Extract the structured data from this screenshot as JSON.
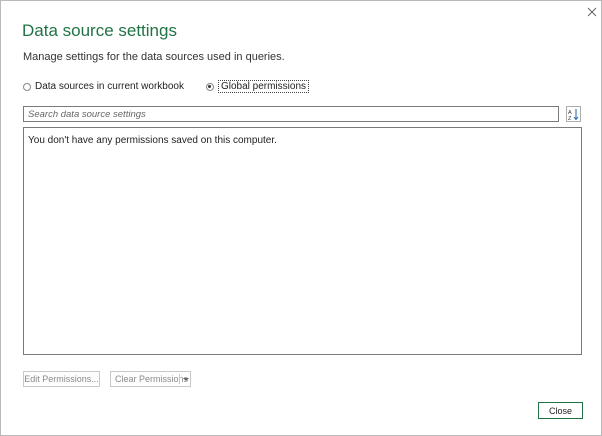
{
  "dialog": {
    "title": "Data source settings",
    "subtitle": "Manage settings for the data sources used in queries.",
    "close_icon": "close-icon"
  },
  "scope": {
    "options": [
      {
        "label": "Data sources in current workbook",
        "checked": false
      },
      {
        "label": "Global permissions",
        "checked": true
      }
    ]
  },
  "search": {
    "placeholder": "Search data source settings",
    "value": "",
    "sort_icon": "sort-az-icon"
  },
  "list": {
    "empty_message": "You don't have any permissions saved on this computer."
  },
  "actions": {
    "edit_label": "Edit Permissions...",
    "clear_label": "Clear Permissions",
    "close_label": "Close"
  },
  "colors": {
    "accent": "#217346",
    "border": "#7a7a7a",
    "disabled_text": "#8a8a8a"
  }
}
